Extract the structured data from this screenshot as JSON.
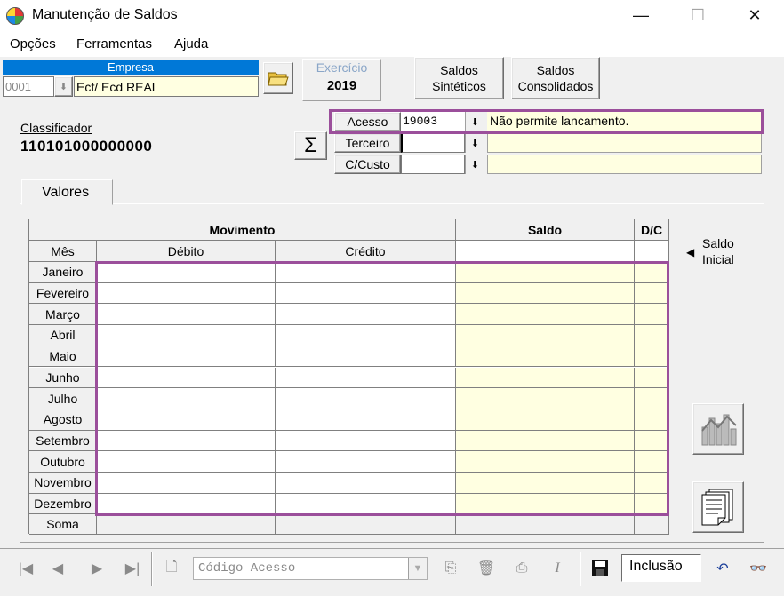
{
  "window": {
    "title": "Manutenção de Saldos",
    "minimize": "—",
    "maximize": "☐",
    "close": "✕"
  },
  "menu": {
    "opcoes": "Opções",
    "ferramentas": "Ferramentas",
    "ajuda": "Ajuda"
  },
  "empresa": {
    "label": "Empresa",
    "code": "0001",
    "name": "Ecf/ Ecd REAL"
  },
  "exercicio": {
    "label": "Exercício",
    "value": "2019"
  },
  "buttons": {
    "saldos_sinteticos": "Saldos Sintéticos",
    "saldos_consolidados": "Saldos Consolidados",
    "sigma": "Σ"
  },
  "classificador": {
    "label": "Classificador",
    "value": "110101000000000"
  },
  "filters": {
    "acesso": {
      "label": "Acesso",
      "value": "19003",
      "desc": "Não permite lancamento."
    },
    "terceiro": {
      "label": "Terceiro",
      "value": "",
      "desc": ""
    },
    "ccusto": {
      "label": "C/Custo",
      "value": "",
      "desc": ""
    }
  },
  "tab": {
    "label": "Valores"
  },
  "grid": {
    "group_movimento": "Movimento",
    "group_saldo": "Saldo",
    "group_dc": "D/C",
    "col_mes": "Mês",
    "col_debito": "Débito",
    "col_credito": "Crédito",
    "months": [
      "Janeiro",
      "Fevereiro",
      "Março",
      "Abril",
      "Maio",
      "Junho",
      "Julho",
      "Agosto",
      "Setembro",
      "Outubro",
      "Novembro",
      "Dezembro"
    ],
    "soma": "Soma"
  },
  "saldo_inicial": {
    "arrow": "◀",
    "line1": "Saldo",
    "line2": "Inicial"
  },
  "toolbar": {
    "search_placeholder": "Código Acesso",
    "mode": "Inclusão"
  },
  "colors": {
    "accent": "#0078d7",
    "highlight": "#9b4f9b",
    "yellow_field": "#ffffe1"
  }
}
